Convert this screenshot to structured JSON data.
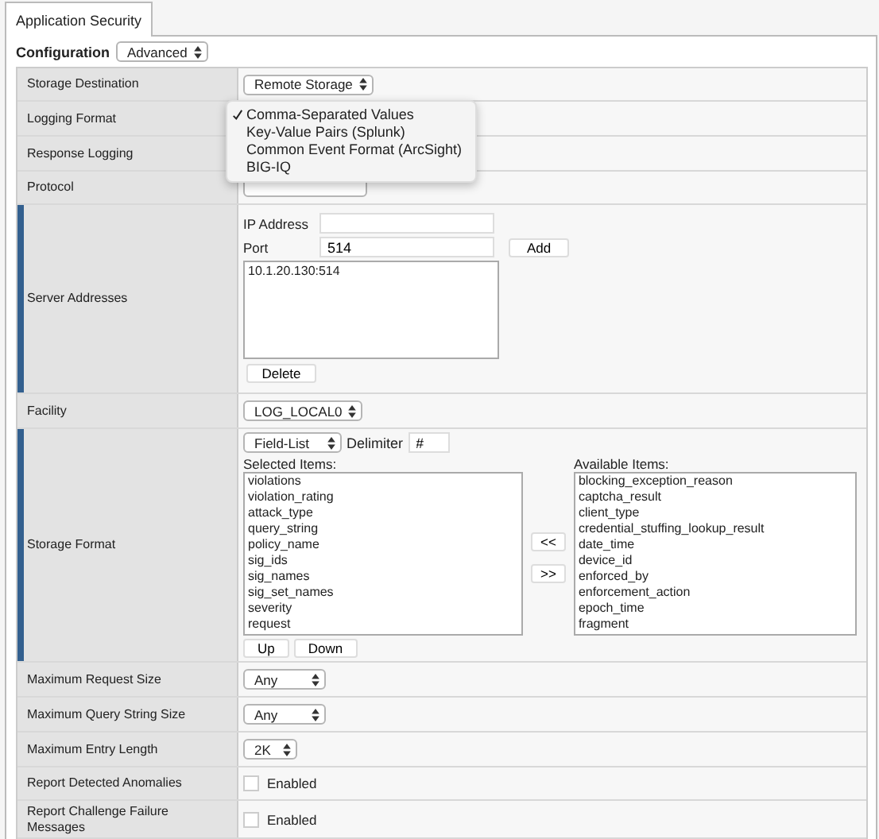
{
  "tabs": [
    {
      "label": "Application Security",
      "selected": true
    }
  ],
  "configuration": {
    "label": "Configuration",
    "mode": "Advanced"
  },
  "rows": [
    {
      "label": "Storage Destination",
      "kind": "select",
      "required": false,
      "value": "Remote Storage"
    },
    {
      "label": "Logging Format",
      "kind": "empty",
      "required": false
    },
    {
      "label": "Response Logging",
      "kind": "empty",
      "required": false
    },
    {
      "label": "Protocol",
      "kind": "covered-select",
      "required": false
    },
    {
      "label": "Server Addresses",
      "kind": "servers",
      "required": true,
      "ip_label": "IP Address",
      "port_label": "Port",
      "port_value": "514",
      "add_button": "Add",
      "addresses": [
        "10.1.20.130:514"
      ],
      "delete_button": "Delete"
    },
    {
      "label": "Facility",
      "kind": "select",
      "required": false,
      "value": "LOG_LOCAL0"
    },
    {
      "label": "Storage Format",
      "kind": "fields",
      "required": true,
      "format": "Field-List",
      "delimiter_label": "Delimiter",
      "delimiter": "#",
      "selected_label": "Selected Items:",
      "selected_items": [
        "violations",
        "violation_rating",
        "attack_type",
        "query_string",
        "policy_name",
        "sig_ids",
        "sig_names",
        "sig_set_names",
        "severity",
        "request"
      ],
      "available_label": "Available Items:",
      "available_items": [
        "blocking_exception_reason",
        "captcha_result",
        "client_type",
        "credential_stuffing_lookup_result",
        "date_time",
        "device_id",
        "enforced_by",
        "enforcement_action",
        "epoch_time",
        "fragment"
      ],
      "remove_button": "<<",
      "add_button": ">>",
      "up_button": "Up",
      "down_button": "Down"
    },
    {
      "label": "Maximum Request Size",
      "kind": "select",
      "required": false,
      "value": "Any"
    },
    {
      "label": "Maximum Query String Size",
      "kind": "select",
      "required": false,
      "value": "Any"
    },
    {
      "label": "Maximum Entry Length",
      "kind": "select",
      "required": false,
      "value": "2K"
    },
    {
      "label": "Report Detected Anomalies",
      "kind": "checkbox",
      "required": false,
      "checkbox_label": "Enabled",
      "checked": false
    },
    {
      "label": "Report Challenge Failure Messages",
      "kind": "checkbox",
      "required": false,
      "checkbox_label": "Enabled",
      "checked": false
    }
  ],
  "logging_format_menu": {
    "options": [
      {
        "label": "Comma-Separated Values",
        "checked": true
      },
      {
        "label": "Key-Value Pairs (Splunk)",
        "checked": false
      },
      {
        "label": "Common Event Format (ArcSight)",
        "checked": false
      },
      {
        "label": "BIG-IQ",
        "checked": false
      }
    ]
  }
}
